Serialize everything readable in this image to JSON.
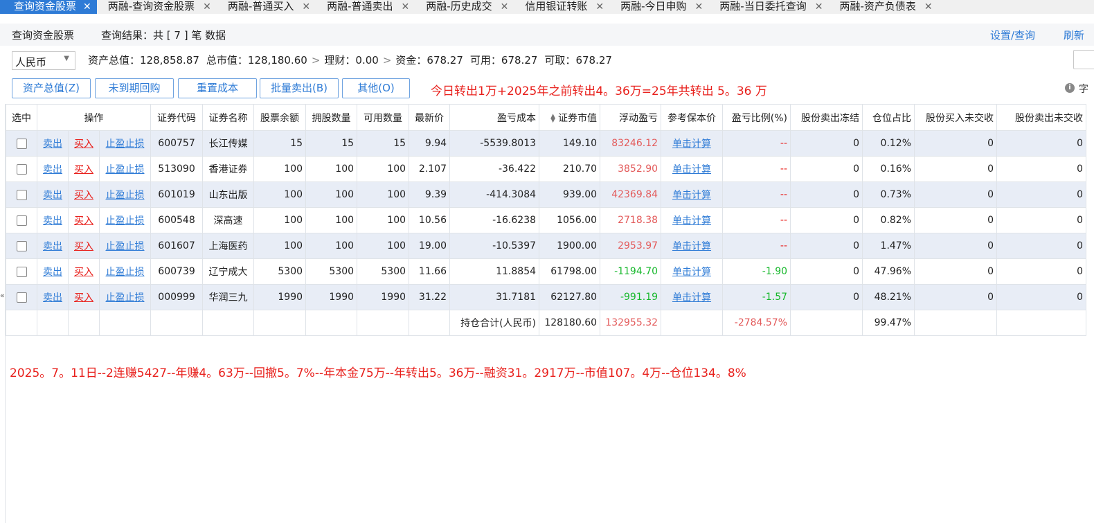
{
  "tabs": [
    {
      "label": "查询资金股票",
      "active": true
    },
    {
      "label": "两融-查询资金股票"
    },
    {
      "label": "两融-普通买入"
    },
    {
      "label": "两融-普通卖出"
    },
    {
      "label": "两融-历史成交"
    },
    {
      "label": "信用银证转账"
    },
    {
      "label": "两融-今日申购"
    },
    {
      "label": "两融-当日委托查询"
    },
    {
      "label": "两融-资产负债表"
    }
  ],
  "header": {
    "title": "查询资金股票",
    "result": "查询结果：共 [ 7 ] 笔 数据",
    "settings_link": "设置/查询",
    "refresh_link": "刷新"
  },
  "assets": {
    "currency": "人民币",
    "total_assets_label": "资产总值：",
    "total_assets": "128,858.87",
    "market_value_label": "总市值：",
    "market_value": "128,180.60",
    "finance_label": "理财：",
    "finance": "0.00",
    "funds_label": "资金：",
    "funds": "678.27",
    "available_label": "可用：",
    "available": "678.27",
    "withdrawable_label": "可取：",
    "withdrawable": "678.27"
  },
  "buttons": {
    "total_assets": "资产总值(Z)",
    "repo": "未到期回购",
    "reset_cost": "重置成本",
    "batch_sell": "批量卖出(B)",
    "other": "其他(O)"
  },
  "note_top": "今日转出1万+2025年之前转出4。36万=25年共转出 5。36  万",
  "info_text": "字",
  "table": {
    "headers": {
      "select": "选中",
      "ops": "操作",
      "code": "证券代码",
      "name": "证券名称",
      "balance": "股票余额",
      "holding": "拥股数量",
      "available": "可用数量",
      "price": "最新价",
      "cost": "盈亏成本",
      "market_value": "证券市值",
      "float_pl": "浮动盈亏",
      "breakeven": "参考保本价",
      "pl_ratio": "盈亏比例(%)",
      "frozen": "股份卖出冻结",
      "position": "仓位占比",
      "buy_unsettled": "股份买入未交收",
      "sell_unsettled": "股份卖出未交收"
    },
    "link_sell": "卖出",
    "link_buy": "买入",
    "link_stop": "止盈止损",
    "link_calc": "单击计算",
    "rows": [
      {
        "code": "600757",
        "name": "长江传媒",
        "balance": "15",
        "holding": "15",
        "available": "15",
        "price": "9.94",
        "cost": "-5539.8013",
        "market_value": "149.10",
        "float_pl": "83246.12",
        "pl_ratio": "--",
        "frozen": "0",
        "position": "0.12%",
        "buy_unsettled": "0",
        "sell_unsettled": "0"
      },
      {
        "code": "513090",
        "name": "香港证券",
        "balance": "100",
        "holding": "100",
        "available": "100",
        "price": "2.107",
        "cost": "-36.422",
        "market_value": "210.70",
        "float_pl": "3852.90",
        "pl_ratio": "--",
        "frozen": "0",
        "position": "0.16%",
        "buy_unsettled": "0",
        "sell_unsettled": "0"
      },
      {
        "code": "601019",
        "name": "山东出版",
        "balance": "100",
        "holding": "100",
        "available": "100",
        "price": "9.39",
        "cost": "-414.3084",
        "market_value": "939.00",
        "float_pl": "42369.84",
        "pl_ratio": "--",
        "frozen": "0",
        "position": "0.73%",
        "buy_unsettled": "0",
        "sell_unsettled": "0"
      },
      {
        "code": "600548",
        "name": "深高速",
        "balance": "100",
        "holding": "100",
        "available": "100",
        "price": "10.56",
        "cost": "-16.6238",
        "market_value": "1056.00",
        "float_pl": "2718.38",
        "pl_ratio": "--",
        "frozen": "0",
        "position": "0.82%",
        "buy_unsettled": "0",
        "sell_unsettled": "0"
      },
      {
        "code": "601607",
        "name": "上海医药",
        "balance": "100",
        "holding": "100",
        "available": "100",
        "price": "19.00",
        "cost": "-10.5397",
        "market_value": "1900.00",
        "float_pl": "2953.97",
        "pl_ratio": "--",
        "frozen": "0",
        "position": "1.47%",
        "buy_unsettled": "0",
        "sell_unsettled": "0"
      },
      {
        "code": "600739",
        "name": "辽宁成大",
        "balance": "5300",
        "holding": "5300",
        "available": "5300",
        "price": "11.66",
        "cost": "11.8854",
        "market_value": "61798.00",
        "float_pl": "-1194.70",
        "pl_ratio": "-1.90",
        "frozen": "0",
        "position": "47.96%",
        "buy_unsettled": "0",
        "sell_unsettled": "0"
      },
      {
        "code": "000999",
        "name": "华润三九",
        "balance": "1990",
        "holding": "1990",
        "available": "1990",
        "price": "31.22",
        "cost": "31.7181",
        "market_value": "62127.80",
        "float_pl": "-991.19",
        "pl_ratio": "-1.57",
        "frozen": "0",
        "position": "48.21%",
        "buy_unsettled": "0",
        "sell_unsettled": "0"
      }
    ],
    "total": {
      "label": "持仓合计(人民币)",
      "market_value": "128180.60",
      "float_pl": "132955.32",
      "pl_ratio": "-2784.57%",
      "position": "99.47%"
    }
  },
  "note_bottom": "2025。7。11日--2连赚5427--年赚4。63万--回撤5。7%--年本金75万--年转出5。36万--融资31。2917万--市值107。4万--仓位134。8%",
  "colors": {
    "accent": "#2e7bd6",
    "loss_red": "#e8201c",
    "profit_pink": "#e35b5b",
    "gain_green": "#16b82b",
    "row_alt": "#e8edf6"
  }
}
